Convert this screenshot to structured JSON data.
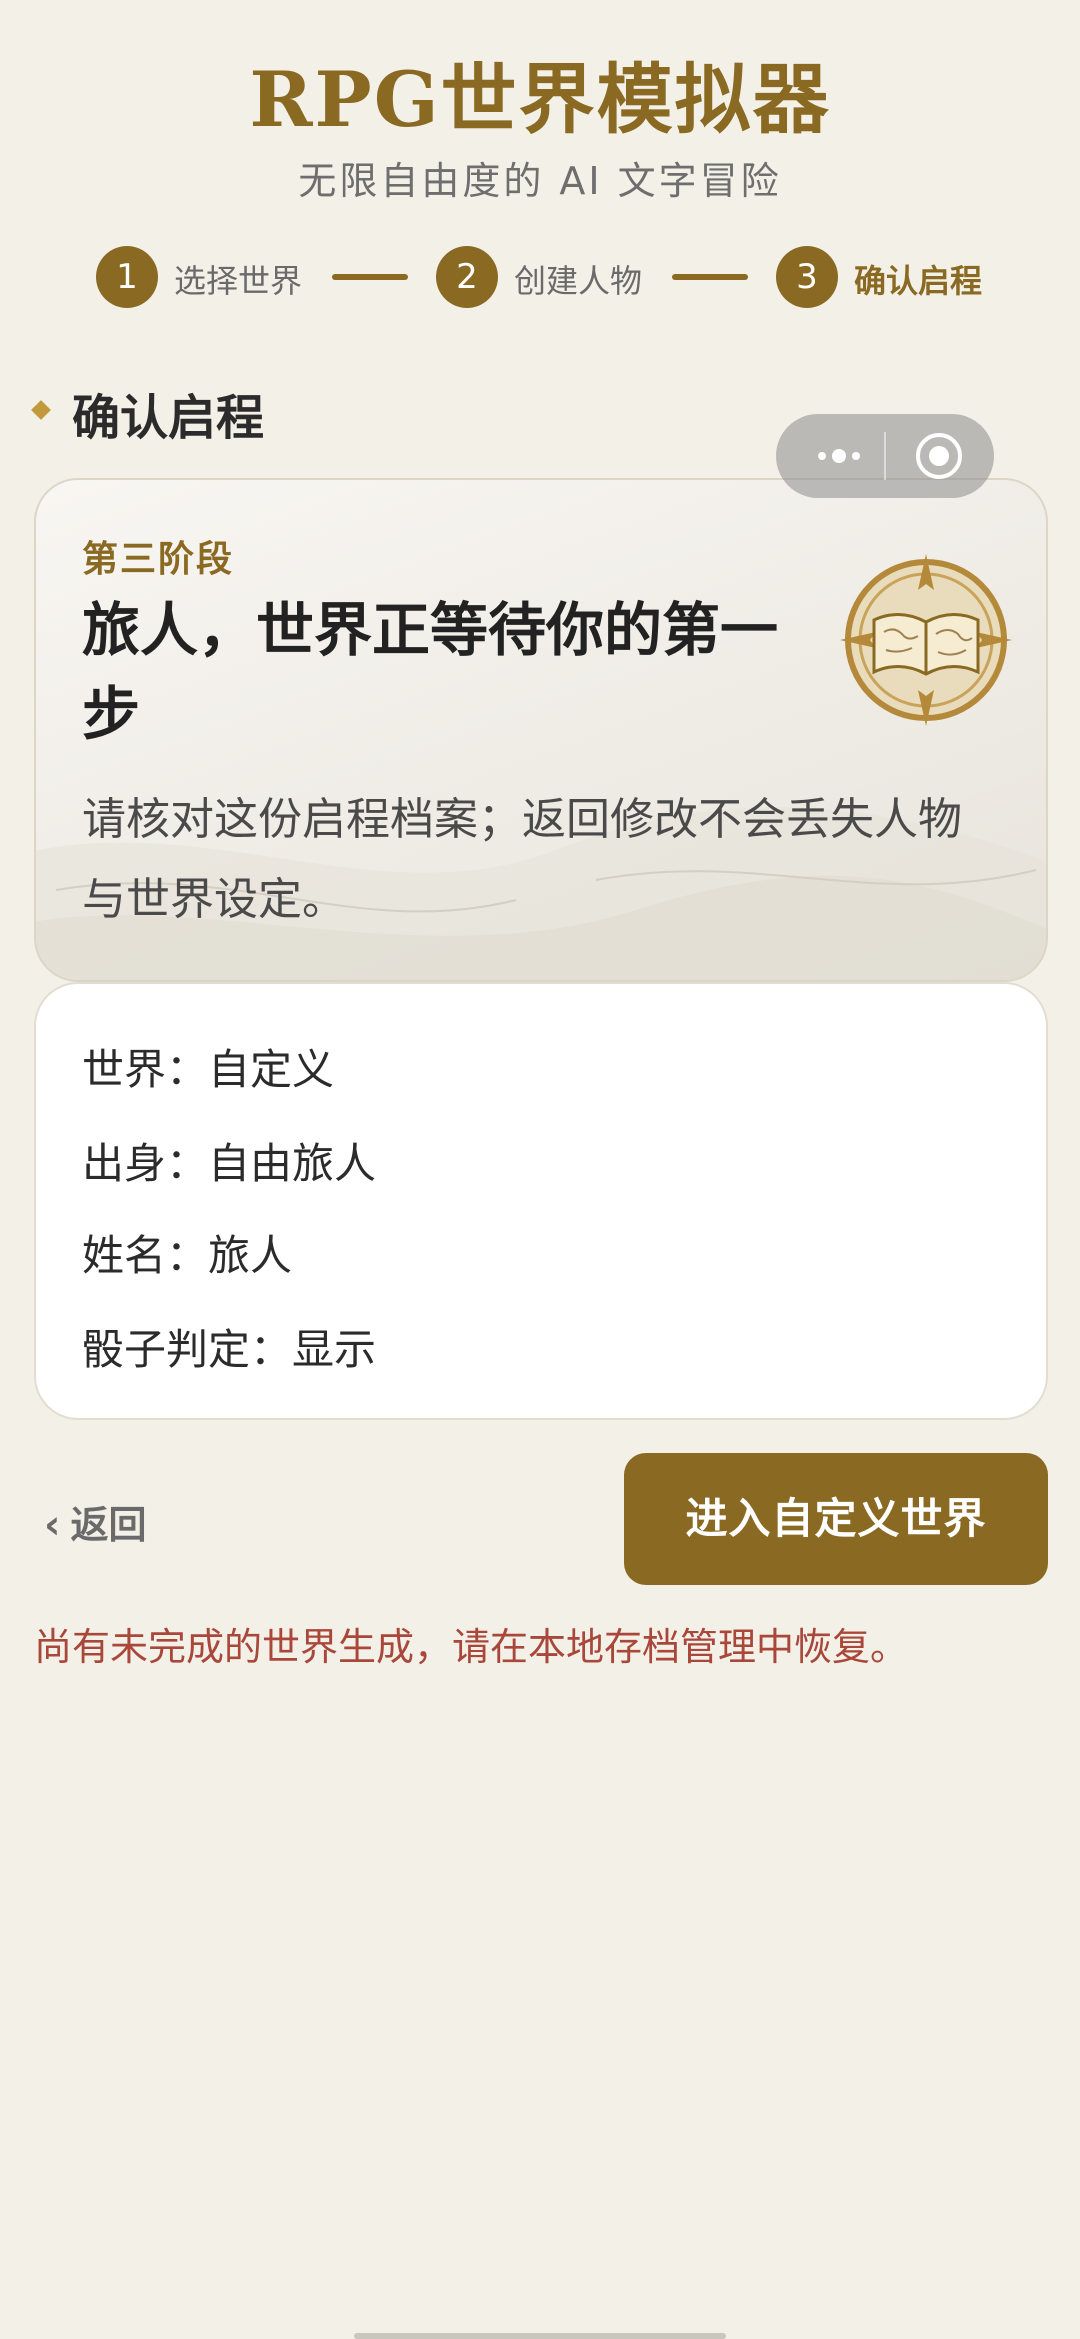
{
  "header": {
    "title": "RPG世界模拟器",
    "subtitle": "无限自由度的 AI 文字冒险"
  },
  "stepper": {
    "steps": [
      {
        "number": "1",
        "label": "选择世界",
        "active": false
      },
      {
        "number": "2",
        "label": "创建人物",
        "active": false
      },
      {
        "number": "3",
        "label": "确认启程",
        "active": true
      }
    ]
  },
  "section": {
    "title": "确认启程"
  },
  "hero": {
    "stage": "第三阶段",
    "headline": "旅人，世界正等待你的第一步",
    "description": "请核对这份启程档案；返回修改不会丢失人物与世界设定。",
    "emblem_icon": "book-compass-icon"
  },
  "summary": {
    "rows": [
      {
        "label": "世界：",
        "value": "自定义"
      },
      {
        "label": "出身：",
        "value": "自由旅人"
      },
      {
        "label": "姓名：",
        "value": "旅人"
      },
      {
        "label": "骰子判定：",
        "value": "显示"
      }
    ]
  },
  "actions": {
    "back_label": "返回",
    "enter_label": "进入自定义世界"
  },
  "warning": "尚有未完成的世界生成，请在本地存档管理中恢复。",
  "colors": {
    "accent": "#8a6a22",
    "background": "#f3f0e8",
    "warning": "#a8473a"
  }
}
